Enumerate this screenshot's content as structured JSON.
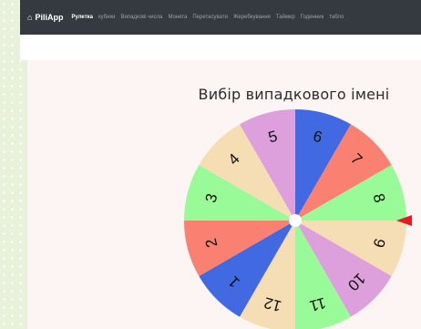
{
  "nav": {
    "brand": "PiliApp",
    "items": [
      {
        "label": "Рулетка",
        "active": true
      },
      {
        "label": "кубики",
        "active": false
      },
      {
        "label": "Випадкові числа",
        "active": false
      },
      {
        "label": "Монета",
        "active": false
      },
      {
        "label": "Перетасувати",
        "active": false
      },
      {
        "label": "Жеребкування",
        "active": false
      },
      {
        "label": "Таймер",
        "active": false
      },
      {
        "label": "Годинник",
        "active": false
      },
      {
        "label": "табло",
        "active": false
      }
    ]
  },
  "main": {
    "title": "Вибір випадкового імені"
  },
  "wheel": {
    "segments": [
      {
        "label": "6",
        "color": "#4169e1"
      },
      {
        "label": "7",
        "color": "#fa8072"
      },
      {
        "label": "8",
        "color": "#98fb98"
      },
      {
        "label": "9",
        "color": "#f5deb3"
      },
      {
        "label": "10",
        "color": "#dda0dd"
      },
      {
        "label": "11",
        "color": "#98fb98"
      },
      {
        "label": "12",
        "color": "#f5deb3"
      },
      {
        "label": "1",
        "color": "#4169e1"
      },
      {
        "label": "2",
        "color": "#fa8072"
      },
      {
        "label": "3",
        "color": "#98fb98"
      },
      {
        "label": "4",
        "color": "#f5deb3"
      },
      {
        "label": "5",
        "color": "#dda0dd"
      }
    ],
    "pointer_color": "#e31b23"
  }
}
